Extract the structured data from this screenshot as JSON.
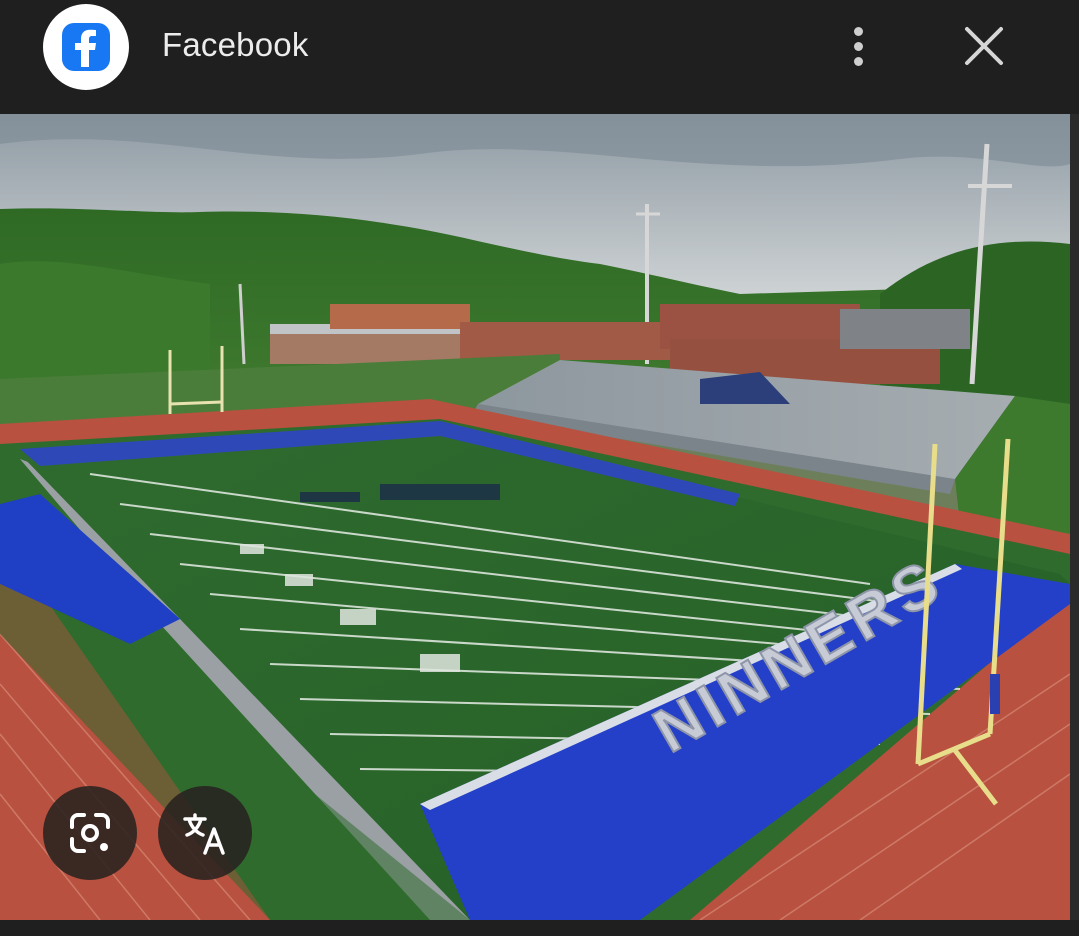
{
  "header": {
    "app_title": "Facebook",
    "logo_icon": "facebook-logo-icon",
    "more_icon": "more-vertical-icon",
    "close_icon": "close-icon"
  },
  "image": {
    "subject": "football-stadium-photo",
    "endzone_text": "NINNERS"
  },
  "actions": {
    "lens_icon": "lens-search-icon",
    "translate_icon": "translate-icon"
  },
  "colors": {
    "bar_background": "#1f1f1f",
    "facebook_blue": "#1877f2",
    "fab_background": "#282220"
  }
}
